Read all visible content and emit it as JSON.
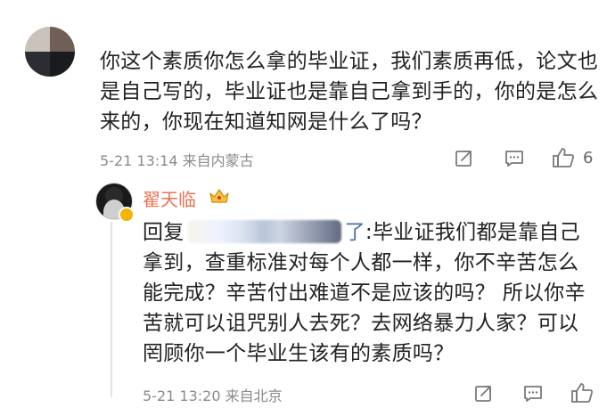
{
  "top_comment": {
    "text": "你这个素质你怎么拿的毕业证，我们素质再低，论文也是自己写的，毕业证也是靠自己拿到手的，你的是怎么来的，你现在知道知网是什么了吗？",
    "meta": "5-21 13:14  来自内蒙古",
    "like_count": "6"
  },
  "reply": {
    "username": "翟天临",
    "prefix": "回复",
    "connector": "了",
    "body": ":毕业证我们都是靠自己拿到，查重标准对每个人都一样，你不辛苦怎么能完成？辛苦付出难道不是应该的吗？ 所以你辛苦就可以诅咒别人去死？去网络暴力人家？可以罔顾你一个毕业生该有的素质吗？",
    "meta": "5-21 13:20  来自北京"
  },
  "colors": {
    "username": "#eb7350",
    "meta": "#8b8b8b",
    "icon": "#7a7a7a",
    "thread_line": "#e4e4e4"
  },
  "icons": [
    "share-icon",
    "comment-icon",
    "like-icon",
    "crown-icon",
    "verified-badge-icon"
  ]
}
